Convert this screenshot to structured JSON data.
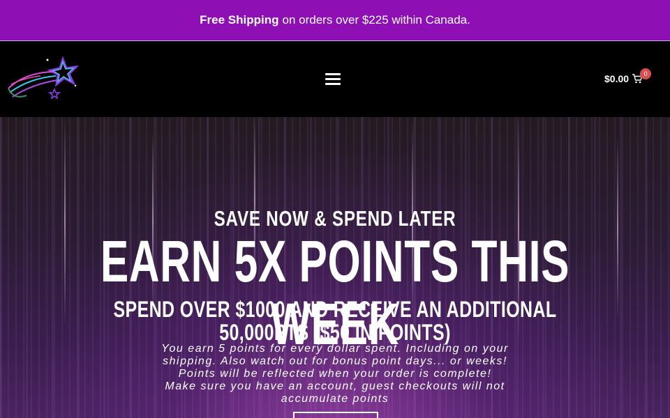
{
  "announcement": {
    "bold": "Free Shipping",
    "rest": "on orders over $225 within Canada."
  },
  "header": {
    "logo_icon": "shooting-star-logo",
    "menu_icon": "hamburger-menu-icon",
    "cart": {
      "total": "$0.00",
      "count": "0",
      "icon": "cart-icon"
    }
  },
  "hero": {
    "kicker": "SAVE NOW & SPEND LATER",
    "headline": "EARN 5X POINTS THIS WEEK",
    "subhead": "SPEND OVER $1000 AND RECEIVE AN ADDITIONAL 50,000PTS ($50 IN POINTS)",
    "body_lines": [
      "You earn 5 points for every dollar spent. Including on your",
      "shipping. Also watch out for bonus point days... or weeks!",
      "Points will be reflected when your order is complete!",
      "Make sure you have an account, guest checkouts will not",
      "accumulate points"
    ]
  },
  "colors": {
    "announcement_bg": "#8e10b5",
    "badge": "#d94f4f"
  }
}
